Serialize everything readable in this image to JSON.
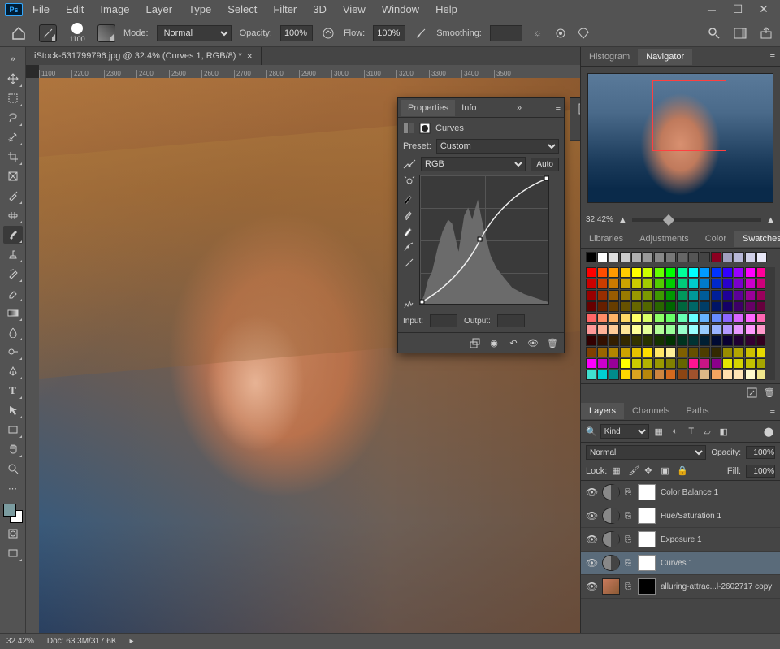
{
  "app": {
    "badge": "Ps"
  },
  "menu": [
    "File",
    "Edit",
    "Image",
    "Layer",
    "Type",
    "Select",
    "Filter",
    "3D",
    "View",
    "Window",
    "Help"
  ],
  "options": {
    "brush_size": "1100",
    "mode_label": "Mode:",
    "blend_mode": "Normal",
    "opacity_label": "Opacity:",
    "opacity_value": "100%",
    "flow_label": "Flow:",
    "flow_value": "100%",
    "smoothing_label": "Smoothing:"
  },
  "document": {
    "tab_title": "iStock-531799796.jpg @ 32.4% (Curves 1, RGB/8) *"
  },
  "ruler_ticks": [
    "1100",
    "2200",
    "2300",
    "2400",
    "2500",
    "2600",
    "2700",
    "2800",
    "2900",
    "3000",
    "3100",
    "3200",
    "3300",
    "3400",
    "3500"
  ],
  "properties": {
    "tabs": [
      "Properties",
      "Info"
    ],
    "title": "Curves",
    "preset_label": "Preset:",
    "preset_value": "Custom",
    "channel": "RGB",
    "auto": "Auto",
    "input_label": "Input:",
    "output_label": "Output:"
  },
  "right": {
    "nav_tabs": [
      "Histogram",
      "Navigator"
    ],
    "zoom": "32.42%",
    "color_tabs": [
      "Libraries",
      "Adjustments",
      "Color",
      "Swatches"
    ],
    "layers_tabs": [
      "Layers",
      "Channels",
      "Paths"
    ],
    "layer_filter": "Kind",
    "blend_mode": "Normal",
    "opacity_label": "Opacity:",
    "opacity_value": "100%",
    "lock_label": "Lock:",
    "fill_label": "Fill:",
    "fill_value": "100%",
    "layers": [
      {
        "name": "Color Balance 1"
      },
      {
        "name": "Hue/Saturation 1"
      },
      {
        "name": "Exposure 1"
      },
      {
        "name": "Curves 1",
        "selected": true
      },
      {
        "name": "alluring-attrac...l-2602717 copy",
        "image": true
      }
    ]
  },
  "status": {
    "zoom": "32.42%",
    "doc_info": "Doc: 63.3M/317.6K"
  },
  "swatches_top": [
    "#000000",
    "#ffffff",
    "#e0e0e0",
    "#cccccc",
    "#b0b0b0",
    "#999999",
    "#888888",
    "#777777",
    "#666666",
    "#555555",
    "#444444",
    "#8b0020",
    "#a0a0c0",
    "#b8b8d8",
    "#d0d0e8",
    "#e8e8f8"
  ],
  "swatches_grid": [
    "#ff0000",
    "#ff4d00",
    "#ff9900",
    "#ffcc00",
    "#ffff00",
    "#ccff00",
    "#66ff00",
    "#00ff00",
    "#00ff99",
    "#00ffff",
    "#0099ff",
    "#0033ff",
    "#3300ff",
    "#9900ff",
    "#ff00ff",
    "#ff0099",
    "#cc0000",
    "#cc3d00",
    "#cc7a00",
    "#cca300",
    "#cccc00",
    "#a3cc00",
    "#52cc00",
    "#00cc00",
    "#00cc7a",
    "#00cccc",
    "#007acc",
    "#0029cc",
    "#2900cc",
    "#7a00cc",
    "#cc00cc",
    "#cc007a",
    "#990000",
    "#992e00",
    "#995c00",
    "#997a00",
    "#999900",
    "#7a9900",
    "#3d9900",
    "#009900",
    "#00995c",
    "#009999",
    "#005c99",
    "#001f99",
    "#1f0099",
    "#5c0099",
    "#990099",
    "#99005c",
    "#660000",
    "#661f00",
    "#663d00",
    "#665200",
    "#666600",
    "#526600",
    "#296600",
    "#006600",
    "#00663d",
    "#006666",
    "#003d66",
    "#001466",
    "#140066",
    "#3d0066",
    "#660066",
    "#66003d",
    "#ff6666",
    "#ff8c66",
    "#ffb366",
    "#ffd966",
    "#ffff66",
    "#d9ff66",
    "#8cff66",
    "#66ff66",
    "#66ffb3",
    "#66ffff",
    "#66b3ff",
    "#668cff",
    "#8c66ff",
    "#d966ff",
    "#ff66ff",
    "#ff66b3",
    "#ff9999",
    "#ffb399",
    "#ffcc99",
    "#ffe699",
    "#ffff99",
    "#e6ff99",
    "#b3ff99",
    "#99ff99",
    "#99ffcc",
    "#99ffff",
    "#99ccff",
    "#99b3ff",
    "#b399ff",
    "#e699ff",
    "#ff99ff",
    "#ff99cc",
    "#330000",
    "#331000",
    "#331f00",
    "#332900",
    "#333300",
    "#293300",
    "#143300",
    "#003300",
    "#00331f",
    "#003333",
    "#001f33",
    "#000a33",
    "#0a0033",
    "#1f0033",
    "#330033",
    "#33001f",
    "#804000",
    "#996600",
    "#b38600",
    "#cca300",
    "#e6c200",
    "#ffde00",
    "#ffe766",
    "#fff099",
    "#806000",
    "#665000",
    "#4d3d00",
    "#332900",
    "#998c00",
    "#b3a600",
    "#ccc000",
    "#e6d900",
    "#ff00ff",
    "#cc00cc",
    "#990099",
    "#ffff00",
    "#cccc00",
    "#b3b300",
    "#999900",
    "#808000",
    "#666600",
    "#ff1493",
    "#c71585",
    "#8b008b",
    "#e6e600",
    "#d4d400",
    "#c2c200",
    "#a6a600",
    "#40e0d0",
    "#00ced1",
    "#008b8b",
    "#ffd700",
    "#daa520",
    "#b8860b",
    "#cd853f",
    "#d2691e",
    "#8b4513",
    "#a0522d",
    "#deb887",
    "#f4a460",
    "#ffdead",
    "#ffe4b5",
    "#fffacd",
    "#f0e68c"
  ]
}
